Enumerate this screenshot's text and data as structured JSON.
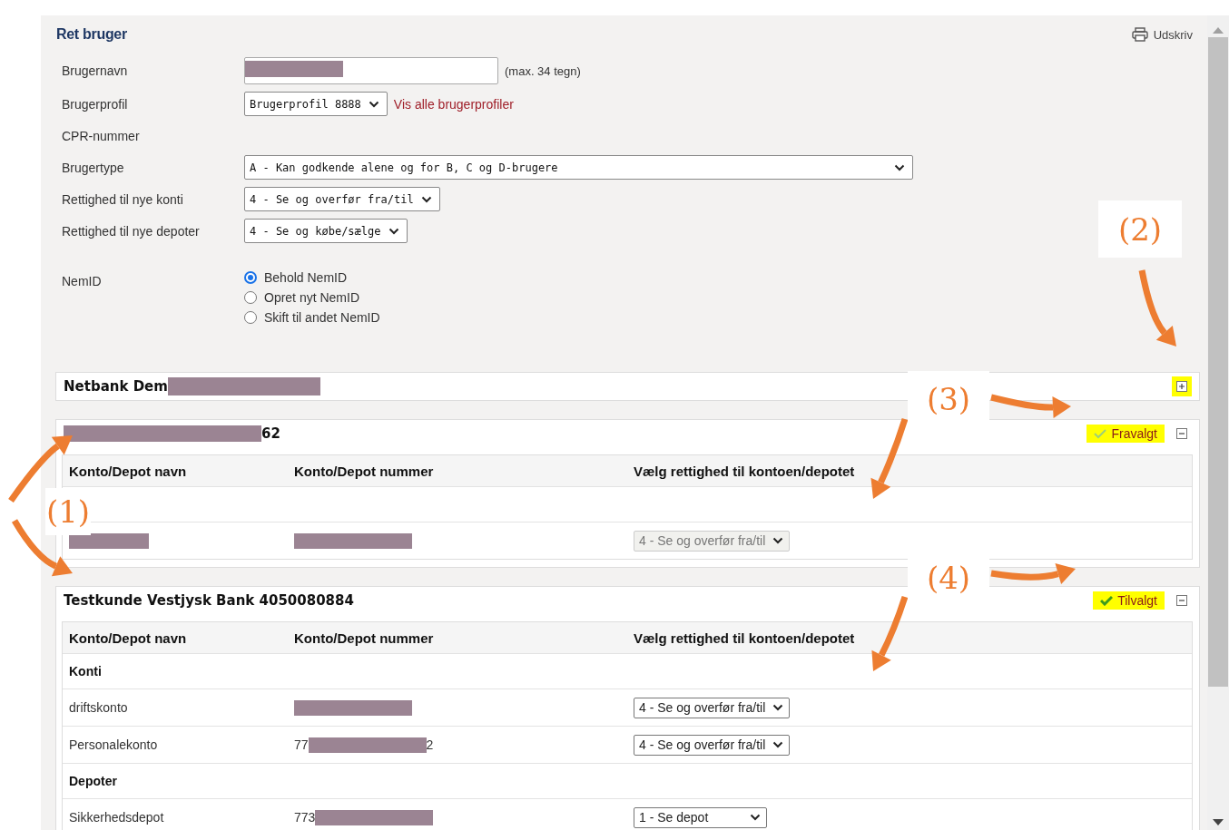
{
  "title": "Ret bruger",
  "print": {
    "label": "Udskriv"
  },
  "fields": [
    {
      "kind": "text",
      "label": "Brugernavn",
      "redacted": true,
      "note": "(max. 34 tegn)"
    },
    {
      "kind": "select",
      "label": "Brugerprofil",
      "value": "Brugerprofil 8888",
      "link": "Vis alle brugerprofiler"
    },
    {
      "kind": "none",
      "label": "CPR-nummer"
    },
    {
      "kind": "select-wide",
      "label": "Brugertype",
      "value": "A - Kan godkende alene og for B, C og D-brugere"
    },
    {
      "kind": "select",
      "label": "Rettighed til nye konti",
      "value": "4 - Se og overfør fra/til"
    },
    {
      "kind": "select",
      "label": "Rettighed til nye depoter",
      "value": "4 - Se og købe/sælge"
    },
    {
      "kind": "radio",
      "label": "NemID",
      "options": [
        {
          "label": "Behold NemID",
          "selected": true
        },
        {
          "label": "Opret nyt NemID",
          "selected": false
        },
        {
          "label": "Skift til andet NemID",
          "selected": false
        }
      ]
    }
  ],
  "sections": [
    {
      "title": [
        {
          "kind": "text",
          "text": "Netbank Dem"
        },
        {
          "kind": "redacted"
        }
      ],
      "expanded": false,
      "toggle_highlighted": true
    },
    {
      "title": [
        {
          "kind": "redacted"
        },
        {
          "kind": "text",
          "text": "62"
        }
      ],
      "expanded": true,
      "toggle_highlighted": false,
      "choice": {
        "label": "Fravalgt",
        "selected": false,
        "highlighted": true
      },
      "columns": [
        "Konto/Depot navn",
        "Konto/Depot nummer",
        "Vælg rettighed til kontoen/depotet"
      ],
      "rows": [
        {
          "kind": "group"
        },
        {
          "kind": "account",
          "name": [
            {
              "kind": "redacted"
            }
          ],
          "number": [
            {
              "kind": "redacted"
            }
          ],
          "permission": {
            "value": "4 - Se og overfør fra/til",
            "disabled": true
          }
        }
      ]
    },
    {
      "title": [
        {
          "kind": "text",
          "text": "Testkunde Vestjysk Bank 4050080884"
        }
      ],
      "expanded": true,
      "toggle_highlighted": false,
      "choice": {
        "label": "Tilvalgt",
        "selected": true,
        "highlighted": true
      },
      "columns": [
        "Konto/Depot navn",
        "Konto/Depot nummer",
        "Vælg rettighed til kontoen/depotet"
      ],
      "rows": [
        {
          "kind": "group",
          "label": "Konti"
        },
        {
          "kind": "account",
          "name": [
            {
              "kind": "text",
              "text": "driftskonto"
            }
          ],
          "number": [
            {
              "kind": "redacted"
            }
          ],
          "permission": {
            "value": "4 - Se og overfør fra/til",
            "disabled": false
          }
        },
        {
          "kind": "account",
          "name": [
            {
              "kind": "text",
              "text": "Personalekonto"
            }
          ],
          "number": [
            {
              "kind": "text",
              "text": "77"
            },
            {
              "kind": "redacted"
            },
            {
              "kind": "text",
              "text": "2"
            }
          ],
          "permission": {
            "value": "4 - Se og overfør fra/til",
            "disabled": false
          }
        },
        {
          "kind": "group",
          "label": "Depoter"
        },
        {
          "kind": "account",
          "name": [
            {
              "kind": "text",
              "text": "Sikkerhedsdepot"
            }
          ],
          "number": [
            {
              "kind": "text",
              "text": "773"
            },
            {
              "kind": "redacted"
            }
          ],
          "permission": {
            "value": "1 - Se depot",
            "disabled": false
          }
        }
      ]
    }
  ],
  "annotations": [
    {
      "label": "(1)"
    },
    {
      "label": "(2)"
    },
    {
      "label": "(3)"
    },
    {
      "label": "(4)"
    }
  ]
}
